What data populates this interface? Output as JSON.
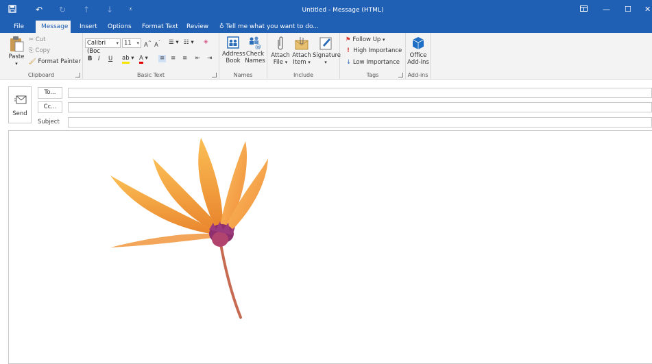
{
  "window": {
    "title": "Untitled - Message (HTML)"
  },
  "tabs": [
    "File",
    "Message",
    "Insert",
    "Options",
    "Format Text",
    "Review"
  ],
  "tell_me": "Tell me what you want to do...",
  "clipboard": {
    "paste": "Paste",
    "cut": "Cut",
    "copy": "Copy",
    "format_painter": "Format Painter",
    "label": "Clipboard"
  },
  "basic_text": {
    "font": "Calibri (Boc",
    "size": "11",
    "bold": "B",
    "italic": "I",
    "underline": "U",
    "label": "Basic Text"
  },
  "names": {
    "address_book_1": "Address",
    "address_book_2": "Book",
    "check_names_1": "Check",
    "check_names_2": "Names",
    "label": "Names"
  },
  "include": {
    "attach_file_1": "Attach",
    "attach_file_2": "File",
    "attach_item_1": "Attach",
    "attach_item_2": "Item",
    "signature": "Signature",
    "label": "Include"
  },
  "tags": {
    "follow_up": "Follow Up",
    "high": "High Importance",
    "low": "Low Importance",
    "label": "Tags"
  },
  "addins": {
    "office_1": "Office",
    "office_2": "Add-ins",
    "label": "Add-ins"
  },
  "compose": {
    "send": "Send",
    "to": "To...",
    "cc": "Cc...",
    "subject": "Subject",
    "to_value": "",
    "cc_value": "",
    "subject_value": ""
  },
  "colors": {
    "accent": "#1f5fb4",
    "ribbon": "#f3f3f3"
  }
}
